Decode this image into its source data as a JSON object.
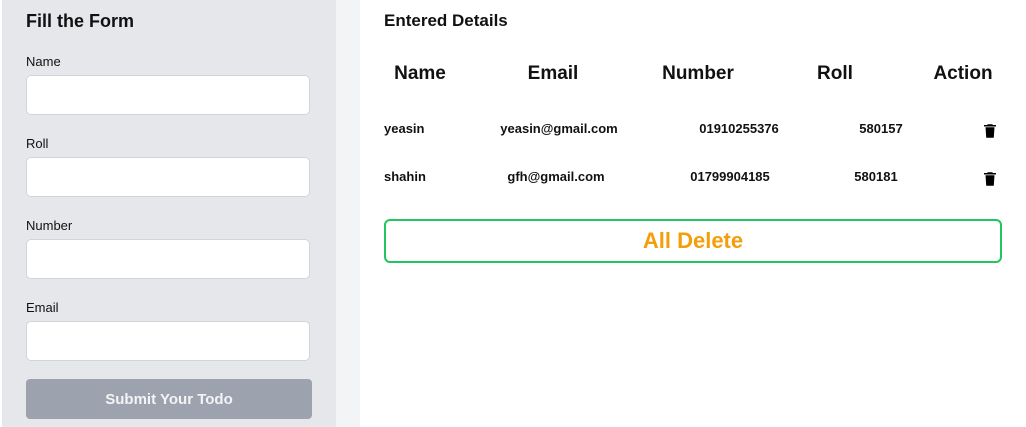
{
  "form": {
    "title": "Fill the Form",
    "fields": [
      {
        "label": "Name",
        "value": "",
        "placeholder": ""
      },
      {
        "label": "Roll",
        "value": "",
        "placeholder": ""
      },
      {
        "label": "Number",
        "value": "",
        "placeholder": ""
      },
      {
        "label": "Email",
        "value": "",
        "placeholder": ""
      }
    ],
    "submit_label": "Submit Your Todo"
  },
  "details": {
    "title": "Entered Details",
    "headers": [
      "Name",
      "Email",
      "Number",
      "Roll",
      "Action"
    ],
    "rows": [
      {
        "name": "yeasin",
        "email": "yeasin@gmail.com",
        "number": "01910255376",
        "roll": "580157",
        "action_icon": "trash-icon"
      },
      {
        "name": "shahin",
        "email": "gfh@gmail.com",
        "number": "01799904185",
        "roll": "580181",
        "action_icon": "trash-icon"
      }
    ],
    "all_delete_label": "All Delete"
  },
  "colors": {
    "form_bg": "#e5e7eb",
    "submit_bg": "#9ca3af",
    "all_delete_border": "#22c55e",
    "all_delete_text": "#f59e0b"
  }
}
